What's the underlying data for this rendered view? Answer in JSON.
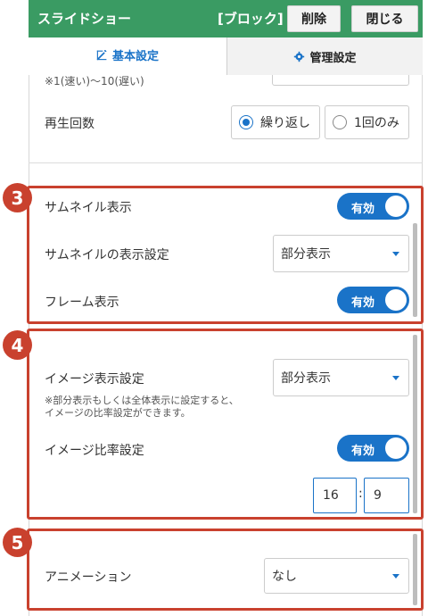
{
  "header": {
    "title": "スライドショー",
    "badge": "[ブロック]",
    "delete_label": "削除",
    "close_label": "閉じる"
  },
  "tabs": {
    "basic": "基本設定",
    "admin": "管理設定"
  },
  "speed_note": "※1(速い)〜10(遅い)",
  "playback": {
    "label": "再生回数",
    "options": [
      "繰り返し",
      "1回のみ"
    ],
    "selected": "繰り返し"
  },
  "markers": {
    "m3": "3",
    "m4": "4",
    "m5": "5"
  },
  "thumbnail": {
    "show_label": "サムネイル表示",
    "show_toggle": "有効",
    "display_label": "サムネイルの表示設定",
    "display_value": "部分表示",
    "frame_label": "フレーム表示",
    "frame_toggle": "有効"
  },
  "image": {
    "display_label": "イメージ表示設定",
    "display_value": "部分表示",
    "note_line1": "※部分表示もしくは全体表示に設定すると、",
    "note_line2": "イメージの比率設定ができます。",
    "ratio_label": "イメージ比率設定",
    "ratio_toggle": "有効",
    "ratio_w": "16",
    "ratio_sep": ":",
    "ratio_h": "9"
  },
  "animation": {
    "label": "アニメーション",
    "value": "なし"
  },
  "colors": {
    "header_green": "#3a9b63",
    "accent_blue": "#1a73c8",
    "highlight_red": "#c9412e"
  }
}
